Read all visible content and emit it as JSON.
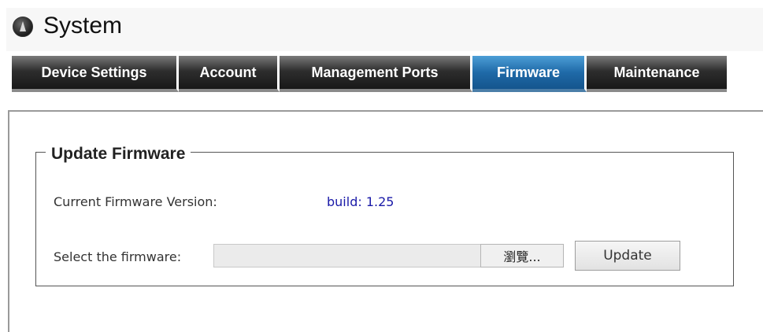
{
  "header": {
    "title": "System",
    "logo_icon": "system-logo-icon"
  },
  "tabs": [
    {
      "label": "Device Settings",
      "active": false
    },
    {
      "label": "Account",
      "active": false
    },
    {
      "label": "Management Ports",
      "active": false
    },
    {
      "label": "Firmware",
      "active": true
    },
    {
      "label": "Maintenance",
      "active": false
    }
  ],
  "firmware": {
    "section_title": "Update Firmware",
    "current_version_label": "Current Firmware Version:",
    "current_version_value": "build: 1.25",
    "select_label": "Select the firmware:",
    "file_input_value": "",
    "browse_label": "瀏覽...",
    "update_label": "Update"
  },
  "colors": {
    "tab_dark": "#181818",
    "tab_active": "#1f6aa8",
    "version_text": "#1a1aa8"
  }
}
